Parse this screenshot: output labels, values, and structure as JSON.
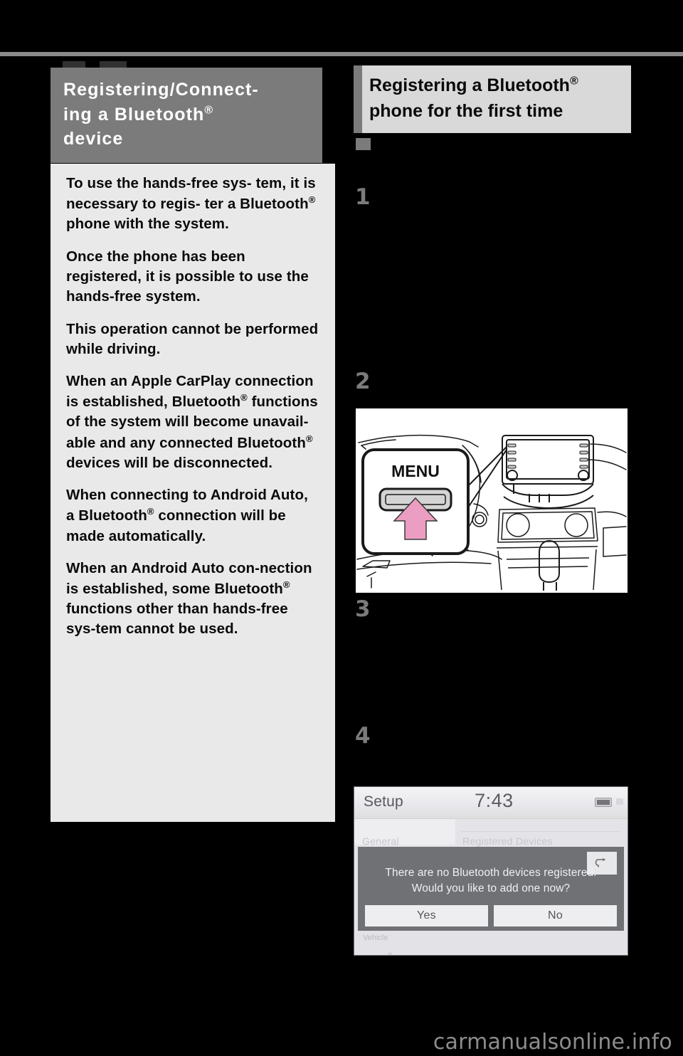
{
  "page": {
    "background_color": "#000000",
    "watermark": "carmanualsonline.info"
  },
  "left_column": {
    "header": {
      "line1": "Registering/Connect-",
      "line2_pre": "ing a Bluetooth",
      "line2_sup": "®",
      "line3": "device",
      "background_color": "#7b7b7b",
      "text_color": "#ffffff"
    },
    "note_box": {
      "background_color": "#e9e9e9",
      "paragraphs": [
        {
          "pre": "To use the hands-free sys-tem, it is necessary to regis-ter a Bluetooth",
          "seg1": "To use the hands-free sys-",
          "seg2": "tem, it is necessary to regis-",
          "seg3": "ter a Bluetooth",
          "sup": "®",
          "seg4": " phone with the system."
        },
        {
          "text": "Once the phone has been registered, it is possible to use the hands-free system."
        },
        {
          "text": "This operation cannot be performed while driving."
        },
        {
          "seg1": "When an Apple CarPlay connection is established, Bluetooth",
          "sup": "®",
          "seg2": " functions of the system will become unavail-able and any connected Bluetooth",
          "sup2": "®",
          "seg3": " devices will be disconnected."
        },
        {
          "seg1": "When connecting to Android Auto, a Bluetooth",
          "sup": "®",
          "seg2": " connection will be made automatically."
        },
        {
          "seg1": "When an Android Auto con-nection is established, some Bluetooth",
          "sup": "®",
          "seg2": " functions other than hands-free sys-tem cannot be used."
        }
      ]
    }
  },
  "right_column": {
    "header": {
      "line1_pre": "Registering a Bluetooth",
      "line1_sup": "®",
      "line2": "phone for the first time",
      "background_color": "#d9d9d9",
      "accent_color": "#7b7b7b",
      "text_color": "#0a0a0a"
    },
    "section_bullet": "square-bullet",
    "steps": [
      {
        "number": "1"
      },
      {
        "number": "2"
      },
      {
        "number": "3"
      },
      {
        "number": "4"
      }
    ],
    "illustration": {
      "callout_label": "MENU",
      "arrow_color": "#eb9ec1",
      "button_fill": "#d4d4d4",
      "line_color": "#1a1a1a",
      "background_color": "#ffffff"
    },
    "screenshot": {
      "title": "Setup",
      "clock": "7:43",
      "status_icon": "sd-card-icon",
      "back_icon": "back-arrow-icon",
      "dialog": {
        "message_line1": "There are no Bluetooth devices registered.",
        "message_line2": "Would you like to add one now?",
        "buttons": [
          {
            "label": "Yes"
          },
          {
            "label": "No"
          }
        ],
        "background_color": "#6f7175"
      },
      "ghost": {
        "tab_left": "General",
        "tab_right": "Registered Devices",
        "footer_hint": "Vehicle"
      }
    }
  }
}
